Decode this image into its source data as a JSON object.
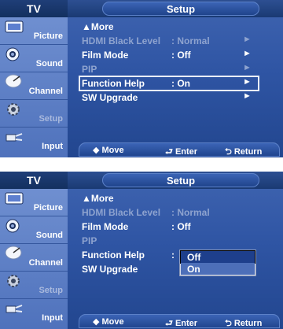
{
  "screens": [
    {
      "title": "TV",
      "header": "Setup",
      "sidebar": [
        {
          "label": "Picture",
          "icon": "picture-icon"
        },
        {
          "label": "Sound",
          "icon": "speaker-icon"
        },
        {
          "label": "Channel",
          "icon": "satellite-dish-icon"
        },
        {
          "label": "Setup",
          "icon": "gear-icon"
        },
        {
          "label": "Input",
          "icon": "plug-icon"
        }
      ],
      "more": "▲More",
      "items": [
        {
          "label": "HDMI Black Level",
          "value": ": Normal",
          "arrow": "►",
          "state": "disabled"
        },
        {
          "label": "Film Mode",
          "value": ": Off",
          "arrow": "►",
          "state": "normal"
        },
        {
          "label": "PIP",
          "value": "",
          "arrow": "►",
          "state": "disabled"
        },
        {
          "label": "Function Help",
          "value": ": On",
          "arrow": "►",
          "state": "selected"
        },
        {
          "label": "SW Upgrade",
          "value": "",
          "arrow": "►",
          "state": "normal"
        }
      ],
      "footer": {
        "move": "◆ Move",
        "enter": "⮐ Enter",
        "return": "⮌ Return"
      }
    },
    {
      "title": "TV",
      "header": "Setup",
      "sidebar": [
        {
          "label": "Picture",
          "icon": "picture-icon"
        },
        {
          "label": "Sound",
          "icon": "speaker-icon"
        },
        {
          "label": "Channel",
          "icon": "satellite-dish-icon"
        },
        {
          "label": "Setup",
          "icon": "gear-icon"
        },
        {
          "label": "Input",
          "icon": "plug-icon"
        }
      ],
      "more": "▲More",
      "items": [
        {
          "label": "HDMI Black Level",
          "value": ": Normal",
          "arrow": "",
          "state": "disabled"
        },
        {
          "label": "Film Mode",
          "value": ": Off",
          "arrow": "",
          "state": "normal"
        },
        {
          "label": "PIP",
          "value": "",
          "arrow": "",
          "state": "disabled"
        },
        {
          "label": "Function Help",
          "value": ":",
          "arrow": "",
          "state": "normal"
        },
        {
          "label": "SW Upgrade",
          "value": "",
          "arrow": "",
          "state": "normal"
        }
      ],
      "dropdown": {
        "selected": "Off",
        "other": "On"
      },
      "footer": {
        "move": "◆ Move",
        "enter": "⮐ Enter",
        "return": "⮌ Return"
      }
    }
  ]
}
